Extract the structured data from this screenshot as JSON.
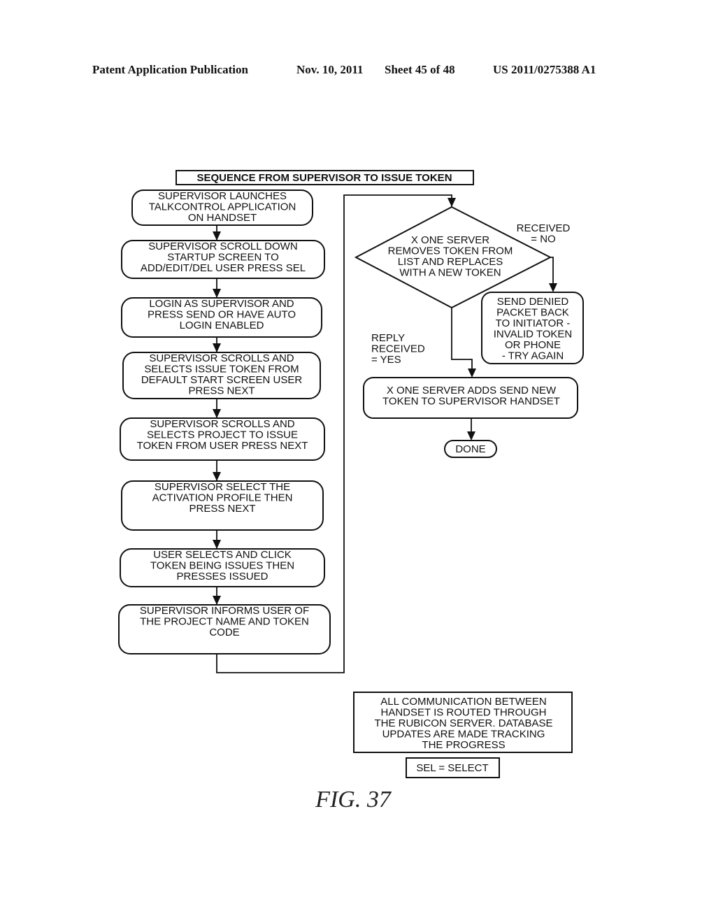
{
  "header": {
    "publication": "Patent Application Publication",
    "date": "Nov. 10, 2011",
    "sheet": "Sheet 45 of 48",
    "number": "US 2011/0275388 A1"
  },
  "diagram": {
    "title": "SEQUENCE FROM SUPERVISOR TO ISSUE TOKEN",
    "left_steps": [
      {
        "lines": [
          "SUPERVISOR LAUNCHES",
          "TALKCONTROL APPLICATION",
          "ON HANDSET"
        ]
      },
      {
        "lines": [
          "SUPERVISOR SCROLL DOWN",
          "STARTUP SCREEN TO",
          "ADD/EDIT/DEL USER PRESS SEL"
        ]
      },
      {
        "lines": [
          "LOGIN AS SUPERVISOR AND",
          "PRESS SEND OR HAVE AUTO",
          "LOGIN ENABLED"
        ]
      },
      {
        "lines": [
          "SUPERVISOR SCROLLS AND",
          "SELECTS ISSUE TOKEN FROM",
          "DEFAULT START SCREEN USER",
          "PRESS NEXT"
        ]
      },
      {
        "lines": [
          "SUPERVISOR SCROLLS AND",
          "SELECTS PROJECT TO ISSUE",
          "TOKEN FROM USER PRESS NEXT"
        ]
      },
      {
        "lines": [
          "SUPERVISOR SELECT THE",
          "ACTIVATION PROFILE THEN",
          "PRESS NEXT"
        ]
      },
      {
        "lines": [
          "USER SELECTS AND CLICK",
          "TOKEN BEING ISSUES THEN",
          "PRESSES ISSUED"
        ]
      },
      {
        "lines": [
          "SUPERVISOR INFORMS USER OF",
          "THE PROJECT NAME AND TOKEN",
          "CODE"
        ]
      }
    ],
    "decision": {
      "lines": [
        "X ONE SERVER",
        "REMOVES TOKEN FROM",
        "LIST AND REPLACES",
        "WITH A NEW TOKEN"
      ]
    },
    "label_no": {
      "lines": [
        "RECEIVED",
        "= NO"
      ]
    },
    "label_yes": {
      "lines": [
        "REPLY",
        "RECEIVED",
        "= YES"
      ]
    },
    "denied": {
      "lines": [
        "SEND DENIED",
        "PACKET BACK",
        "TO INITIATOR -",
        "INVALID TOKEN",
        "OR PHONE",
        "- TRY AGAIN"
      ]
    },
    "server_adds": {
      "lines": [
        "X ONE SERVER ADDS SEND NEW",
        "TOKEN TO SUPERVISOR HANDSET"
      ]
    },
    "done": "DONE",
    "note": {
      "lines": [
        "ALL COMMUNICATION BETWEEN",
        "HANDSET IS ROUTED THROUGH",
        "THE RUBICON SERVER.  DATABASE",
        "UPDATES ARE MADE TRACKING",
        "THE PROGRESS"
      ]
    },
    "legend": "SEL = SELECT",
    "figure_label": "FIG. 37"
  }
}
